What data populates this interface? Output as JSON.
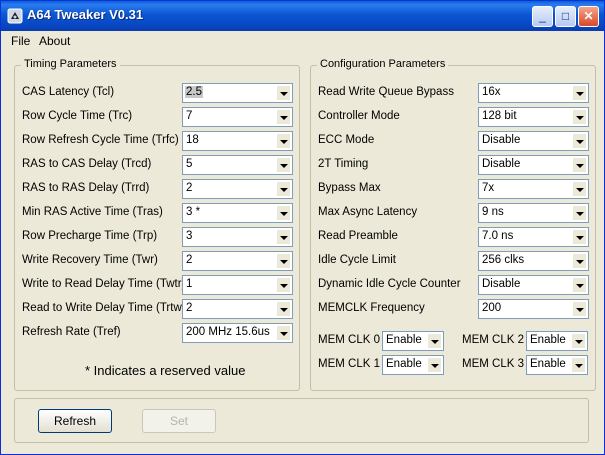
{
  "window": {
    "title": "A64 Tweaker V0.31",
    "controls": {
      "minimize": "_",
      "maximize": "□",
      "close": "✕"
    }
  },
  "menu": {
    "file": "File",
    "about": "About"
  },
  "timing": {
    "title": "Timing Parameters",
    "rows": [
      {
        "label": "CAS Latency (Tcl)",
        "value": "2.5"
      },
      {
        "label": "Row Cycle Time (Trc)",
        "value": "7"
      },
      {
        "label": "Row Refresh Cycle Time (Trfc)",
        "value": "18"
      },
      {
        "label": "RAS to CAS Delay (Trcd)",
        "value": "5"
      },
      {
        "label": "RAS to RAS Delay (Trrd)",
        "value": "2"
      },
      {
        "label": "Min RAS Active Time (Tras)",
        "value": "3 *"
      },
      {
        "label": "Row Precharge Time (Trp)",
        "value": "3"
      },
      {
        "label": "Write Recovery Time (Twr)",
        "value": "2"
      },
      {
        "label": "Write to Read Delay Time (Twtr)",
        "value": "1"
      },
      {
        "label": "Read to Write Delay Time (Trtw)",
        "value": "2"
      },
      {
        "label": "Refresh Rate (Tref)",
        "value": "200 MHz 15.6us"
      }
    ],
    "note": "* Indicates a reserved value"
  },
  "config": {
    "title": "Configuration Parameters",
    "rows": [
      {
        "label": "Read Write Queue Bypass",
        "value": "16x"
      },
      {
        "label": "Controller Mode",
        "value": "128 bit"
      },
      {
        "label": "ECC Mode",
        "value": "Disable"
      },
      {
        "label": "2T Timing",
        "value": "Disable"
      },
      {
        "label": "Bypass Max",
        "value": "7x"
      },
      {
        "label": "Max Async Latency",
        "value": "9 ns"
      },
      {
        "label": "Read Preamble",
        "value": "7.0 ns"
      },
      {
        "label": "Idle Cycle Limit",
        "value": "256 clks"
      },
      {
        "label": "Dynamic Idle Cycle Counter",
        "value": "Disable"
      },
      {
        "label": "MEMCLK Frequency",
        "value": "200"
      }
    ],
    "memclk": [
      {
        "label": "MEM CLK 0",
        "value": "Enable"
      },
      {
        "label": "MEM CLK 2",
        "value": "Enable"
      },
      {
        "label": "MEM CLK 1",
        "value": "Enable"
      },
      {
        "label": "MEM CLK 3",
        "value": "Enable"
      }
    ]
  },
  "buttons": {
    "refresh": "Refresh",
    "set": "Set"
  }
}
